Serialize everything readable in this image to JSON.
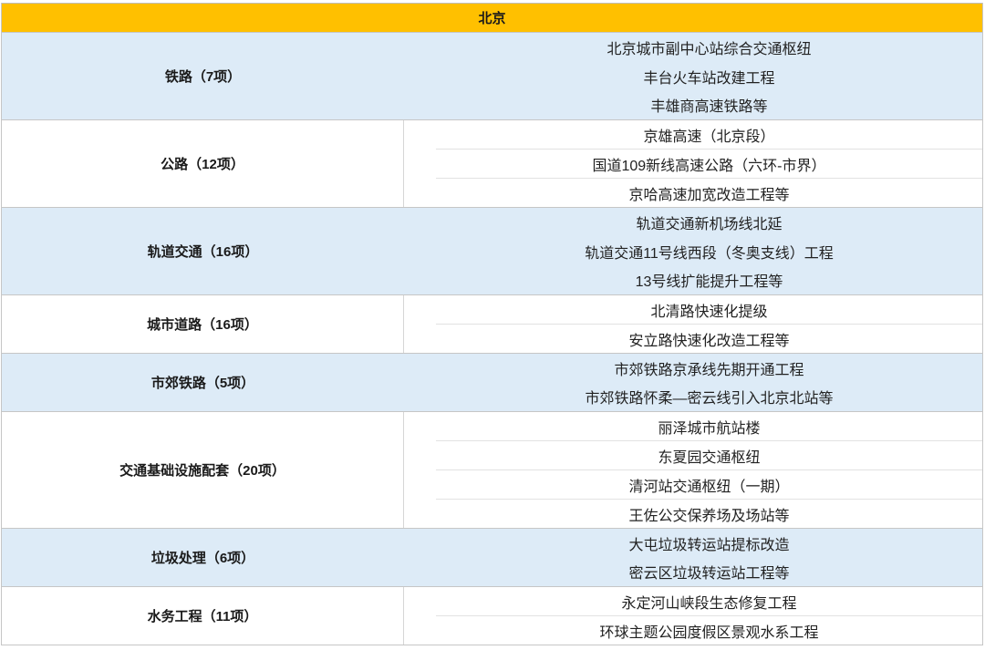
{
  "header": {
    "title": "北京"
  },
  "colors": {
    "header_bg": "#FFC000",
    "band_bg": "#DDEBF7",
    "border": "#C6C6C6"
  },
  "groups": [
    {
      "label": "铁路（7项）",
      "items": [
        "北京城市副中心站综合交通枢纽",
        "丰台火车站改建工程",
        "丰雄商高速铁路等"
      ]
    },
    {
      "label": "公路（12项）",
      "items": [
        "京雄高速（北京段）",
        "国道109新线高速公路（六环-市界）",
        "京哈高速加宽改造工程等"
      ]
    },
    {
      "label": "轨道交通（16项）",
      "items": [
        "轨道交通新机场线北延",
        "轨道交通11号线西段（冬奥支线）工程",
        "13号线扩能提升工程等"
      ]
    },
    {
      "label": "城市道路（16项）",
      "items": [
        "北清路快速化提级",
        "安立路快速化改造工程等"
      ]
    },
    {
      "label": "市郊铁路（5项）",
      "items": [
        "市郊铁路京承线先期开通工程",
        "市郊铁路怀柔—密云线引入北京北站等"
      ]
    },
    {
      "label": "交通基础设施配套（20项）",
      "items": [
        "丽泽城市航站楼",
        "东夏园交通枢纽",
        "清河站交通枢纽（一期）",
        "王佐公交保养场及场站等"
      ]
    },
    {
      "label": "垃圾处理（6项）",
      "items": [
        "大屯垃圾转运站提标改造",
        "密云区垃圾转运站工程等"
      ]
    },
    {
      "label": "水务工程（11项）",
      "items": [
        "永定河山峡段生态修复工程",
        "环球主题公园度假区景观水系工程"
      ]
    }
  ]
}
